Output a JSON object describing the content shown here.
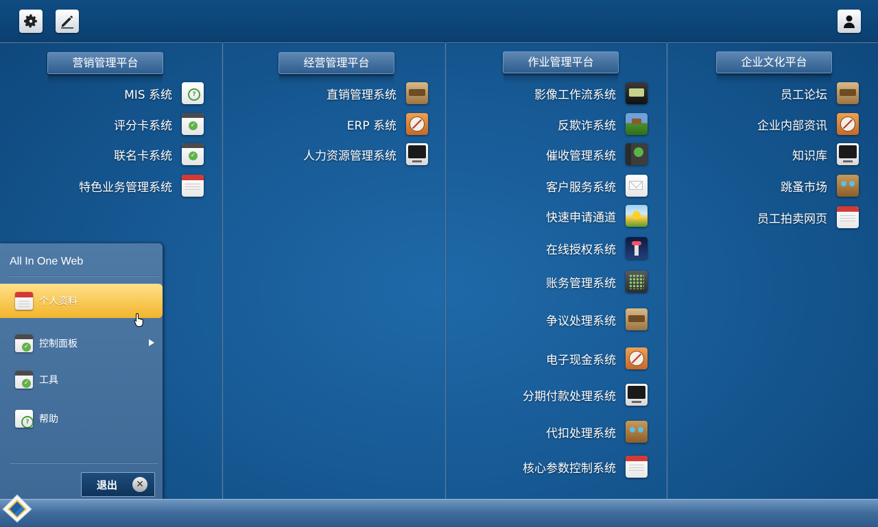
{
  "topbar": {
    "settings_icon": "gear-icon",
    "edit_icon": "pencil-icon",
    "user_icon": "user-icon"
  },
  "sections": [
    {
      "title": "营销管理平台",
      "items": [
        {
          "label": "MIS 系统",
          "icon": "cloud-icon"
        },
        {
          "label": "评分卡系统",
          "icon": "check-window-icon"
        },
        {
          "label": "联名卡系统",
          "icon": "check-window-icon"
        },
        {
          "label": "特色业务管理系统",
          "icon": "calendar-icon"
        }
      ]
    },
    {
      "title": "经营管理平台",
      "items": [
        {
          "label": "直销管理系统",
          "icon": "box-icon"
        },
        {
          "label": "ERP 系统",
          "icon": "compass-icon"
        },
        {
          "label": "人力资源管理系统",
          "icon": "monitor-icon"
        }
      ]
    },
    {
      "title": "作业管理平台",
      "items": [
        {
          "label": "影像工作流系统",
          "icon": "film-icon"
        },
        {
          "label": "反欺诈系统",
          "icon": "grass-icon"
        },
        {
          "label": "催收管理系统",
          "icon": "book-icon"
        },
        {
          "label": "客户服务系统",
          "icon": "mail-icon"
        },
        {
          "label": "快速申请通道",
          "icon": "sun-icon"
        },
        {
          "label": "在线授权系统",
          "icon": "lighthouse-icon"
        },
        {
          "label": "账务管理系统",
          "icon": "calculator-icon"
        },
        {
          "label": "争议处理系统",
          "icon": "box-icon"
        },
        {
          "label": "电子现金系统",
          "icon": "compass-icon"
        },
        {
          "label": "分期付款处理系统",
          "icon": "monitor-icon"
        },
        {
          "label": "代扣处理系统",
          "icon": "owl-icon"
        },
        {
          "label": "核心参数控制系统",
          "icon": "calendar-icon"
        }
      ]
    },
    {
      "title": "企业文化平台",
      "items": [
        {
          "label": "员工论坛",
          "icon": "box-icon"
        },
        {
          "label": "企业内部资讯",
          "icon": "compass-icon"
        },
        {
          "label": "知识库",
          "icon": "monitor-icon"
        },
        {
          "label": "跳蚤市场",
          "icon": "owl-icon"
        },
        {
          "label": "员工拍卖网页",
          "icon": "calendar-icon"
        }
      ]
    }
  ],
  "menu": {
    "title": "All In One Web",
    "items": [
      {
        "label": "个人资料",
        "icon": "calendar-icon",
        "active": true
      },
      {
        "label": "控制面板",
        "icon": "check-window-icon",
        "has_submenu": true
      },
      {
        "label": "工具",
        "icon": "check-window-icon"
      },
      {
        "label": "帮助",
        "icon": "cloud-icon"
      }
    ],
    "exit_label": "退出",
    "exit_icon": "close-icon"
  },
  "taskbar": {
    "start_icon": "start-logo-icon"
  },
  "colors": {
    "background": "#175a95",
    "menu_active": "#f3b52c",
    "header": "#3e6b9b"
  }
}
